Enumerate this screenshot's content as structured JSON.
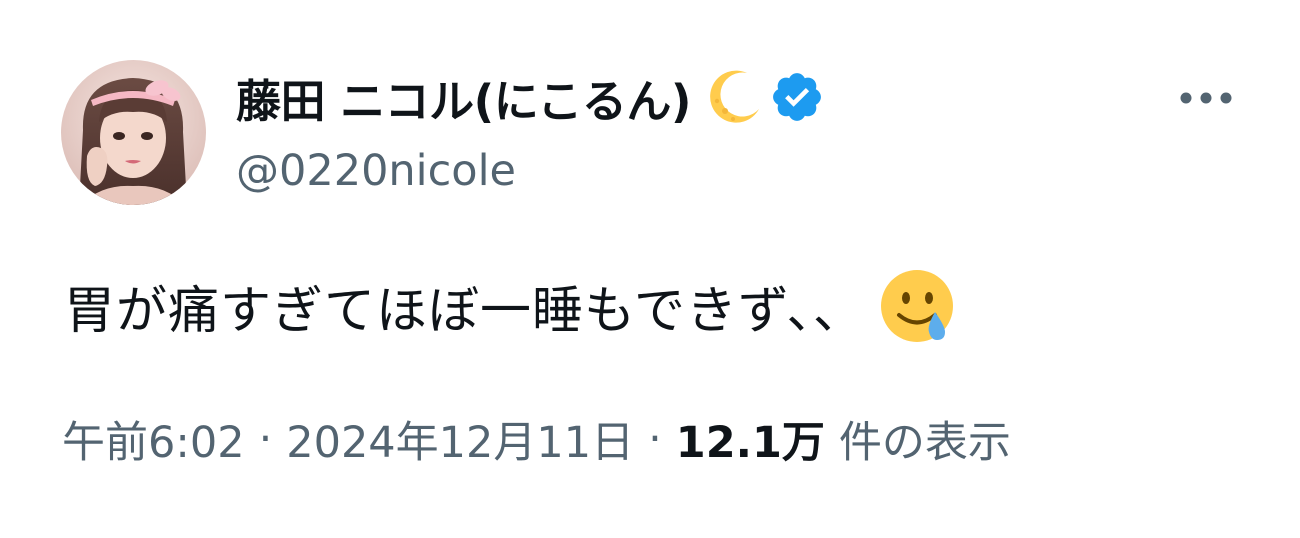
{
  "author": {
    "display_name": "藤田 ニコル(にこるん)",
    "handle": "@0220nicole",
    "verified": true,
    "name_emoji": "crescent-moon-icon"
  },
  "tweet": {
    "text": "胃が痛すぎてほぼ一睡もできず、、",
    "trailing_emoji": "face-holding-back-tears-icon"
  },
  "meta": {
    "time": "午前6:02",
    "separator": "·",
    "date": "2024年12月11日",
    "views_count": "12.1万",
    "views_label": "件の表示"
  },
  "colors": {
    "text_primary": "#0f1419",
    "text_secondary": "#536471",
    "verified_blue": "#1d9bf0",
    "background": "#ffffff"
  },
  "icons": {
    "more": "more-horizontal-icon",
    "verified": "verified-badge-icon"
  }
}
